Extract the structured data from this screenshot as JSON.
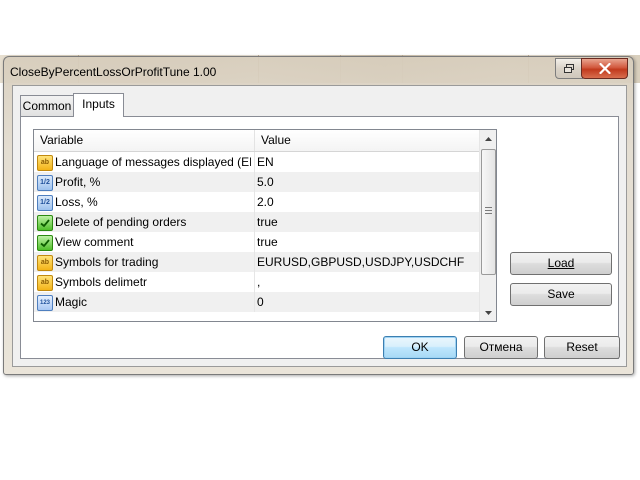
{
  "window": {
    "title": "CloseByPercentLossOrProfitTune 1.00"
  },
  "tabs": [
    {
      "label": "Common"
    },
    {
      "label": "Inputs"
    }
  ],
  "grid": {
    "columns": {
      "variable": "Variable",
      "value": "Value"
    },
    "rows": [
      {
        "icon": "ab",
        "icon_name": "string-type-icon",
        "variable": "Language of messages displayed (EN, ...",
        "value": "EN"
      },
      {
        "icon": "1/2",
        "icon_name": "double-type-icon",
        "variable": "Profit, %",
        "value": "5.0"
      },
      {
        "icon": "1/2",
        "icon_name": "double-type-icon",
        "variable": "Loss, %",
        "value": "2.0"
      },
      {
        "icon": "bool",
        "icon_name": "bool-type-icon",
        "variable": "Delete of pending orders",
        "value": "true"
      },
      {
        "icon": "bool",
        "icon_name": "bool-type-icon",
        "variable": "View comment",
        "value": "true"
      },
      {
        "icon": "ab",
        "icon_name": "string-type-icon",
        "variable": "Symbols for trading",
        "value": "EURUSD,GBPUSD,USDJPY,USDCHF"
      },
      {
        "icon": "ab",
        "icon_name": "string-type-icon",
        "variable": "Symbols delimetr",
        "value": ","
      },
      {
        "icon": "123",
        "icon_name": "integer-type-icon",
        "variable": "Magic",
        "value": "0"
      }
    ]
  },
  "buttons": {
    "load_label": "Load",
    "save_label": "Save",
    "ok_label": "OK",
    "cancel_label": "Отмена",
    "reset_label": "Reset"
  }
}
